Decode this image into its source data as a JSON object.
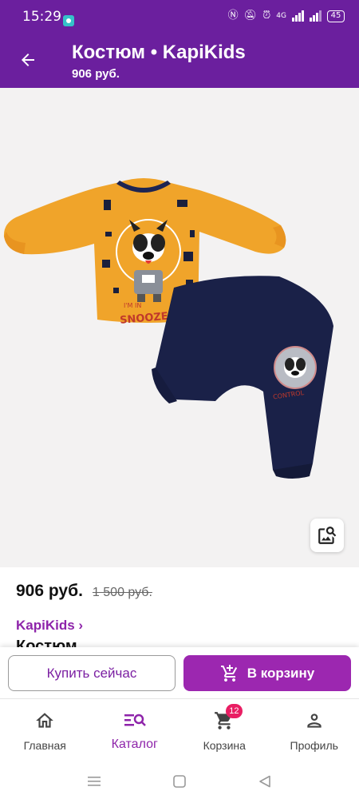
{
  "status_bar": {
    "time": "15:29",
    "network": "4G",
    "battery": "45"
  },
  "app_bar": {
    "title": "Костюм • KapiKids",
    "subtitle": "906 руб."
  },
  "product": {
    "price": "906 руб.",
    "old_price": "1 500 руб.",
    "brand": "KapiKids ›",
    "name": "Костюм",
    "print_text_top": "I'M IN",
    "print_text_main": "SNOOZE CONTROL",
    "print_text_pants": "CONTROL"
  },
  "actions": {
    "buy_now": "Купить сейчас",
    "add_to_cart": "В корзину"
  },
  "bottom_nav": {
    "items": [
      {
        "label": "Главная",
        "icon": "home-icon"
      },
      {
        "label": "Каталог",
        "icon": "catalog-icon"
      },
      {
        "label": "Корзина",
        "icon": "cart-icon",
        "badge": "12"
      },
      {
        "label": "Профиль",
        "icon": "profile-icon"
      }
    ]
  },
  "colors": {
    "primary_dark": "#6b1f9e",
    "accent": "#9c27b0",
    "badge": "#e91e63"
  }
}
